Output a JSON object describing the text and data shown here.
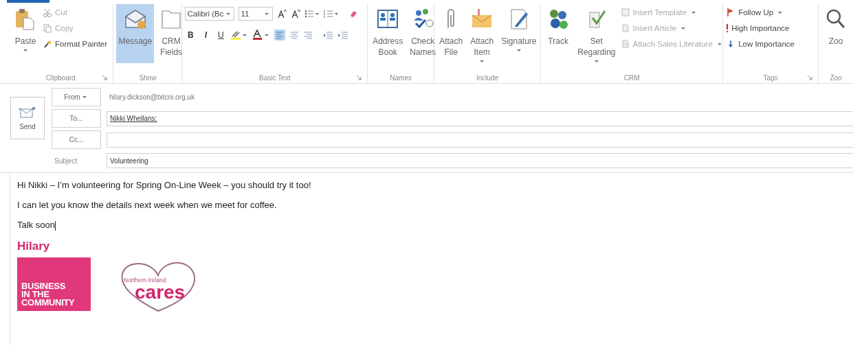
{
  "ribbon": {
    "groups": [
      {
        "label": "Clipboard",
        "launcher": true,
        "items": [
          {
            "kind": "large",
            "lines": [
              "Paste"
            ],
            "dropdown": true,
            "selected": false
          },
          {
            "kind": "stack",
            "items": [
              {
                "label": "Cut",
                "disabled": true,
                "dropdown": false
              },
              {
                "label": "Copy",
                "disabled": true,
                "dropdown": false
              },
              {
                "label": "Format Painter",
                "disabled": false,
                "dropdown": false
              }
            ]
          }
        ]
      },
      {
        "label": "Show",
        "launcher": false,
        "items": [
          {
            "kind": "large",
            "lines": [
              "Message"
            ],
            "dropdown": false,
            "selected": true
          },
          {
            "kind": "large",
            "lines": [
              "CRM",
              "Fields"
            ],
            "dropdown": false,
            "selected": false
          }
        ]
      },
      {
        "label": "Basic Text",
        "launcher": true,
        "items": [
          {
            "kind": "basic_text",
            "font": "Calibri (Bc",
            "size": "11",
            "styles": [
              "B",
              "I",
              "U"
            ]
          }
        ]
      },
      {
        "label": "Names",
        "launcher": false,
        "items": [
          {
            "kind": "large",
            "lines": [
              "Address",
              "Book"
            ],
            "dropdown": false,
            "selected": false
          },
          {
            "kind": "large",
            "lines": [
              "Check",
              "Names"
            ],
            "dropdown": false,
            "selected": false
          }
        ]
      },
      {
        "label": "Include",
        "launcher": false,
        "items": [
          {
            "kind": "large",
            "lines": [
              "Attach",
              "File"
            ],
            "dropdown": false,
            "selected": false
          },
          {
            "kind": "large",
            "lines": [
              "Attach",
              "Item"
            ],
            "dropdown": true,
            "selected": false
          },
          {
            "kind": "large",
            "lines": [
              "Signature"
            ],
            "dropdown": true,
            "selected": false
          }
        ]
      },
      {
        "label": "CRM",
        "launcher": false,
        "items": [
          {
            "kind": "large",
            "lines": [
              "Track"
            ],
            "dropdown": false,
            "selected": false
          },
          {
            "kind": "large",
            "lines": [
              "Set",
              "Regarding"
            ],
            "dropdown": true,
            "selected": false
          },
          {
            "kind": "stack",
            "items": [
              {
                "label": "Insert Template",
                "disabled": true,
                "dropdown": true
              },
              {
                "label": "Insert Article",
                "disabled": true,
                "dropdown": true
              },
              {
                "label": "Attach Sales Literature",
                "disabled": true,
                "dropdown": true
              }
            ]
          }
        ]
      },
      {
        "label": "Tags",
        "launcher": true,
        "items": [
          {
            "kind": "stack",
            "items": [
              {
                "label": "Follow Up",
                "disabled": false,
                "dropdown": true
              },
              {
                "label": "High Importance",
                "disabled": false,
                "dropdown": false
              },
              {
                "label": "Low Importance",
                "disabled": false,
                "dropdown": false
              }
            ]
          }
        ]
      },
      {
        "label": "Zoo",
        "launcher": false,
        "items": [
          {
            "kind": "large",
            "lines": [
              "Zoo"
            ],
            "dropdown": false,
            "selected": false
          }
        ]
      }
    ]
  },
  "header": {
    "send": "Send",
    "from": {
      "button": "From",
      "value": "hilary.dickson@bitcni.org.uk"
    },
    "to": {
      "button": "To...",
      "value": "Nikki Whellans;"
    },
    "cc": {
      "button": "Cc..."
    },
    "subject": {
      "label": "Subject",
      "value": "Volunteering"
    }
  },
  "body": {
    "paragraphs": [
      "Hi Nikki – I’m volunteering for Spring On-Line Week – you should try it too!",
      "I can let you know the details next week when we meet for coffee.",
      "Talk soon"
    ],
    "signature": {
      "name": "Hilary",
      "logos": [
        {
          "kind": "block",
          "lines": [
            "BUSINESS",
            "IN THE",
            "COMMUNITY"
          ]
        },
        {
          "kind": "heart",
          "small": "Northern Ireland",
          "large": "cares"
        }
      ]
    }
  }
}
